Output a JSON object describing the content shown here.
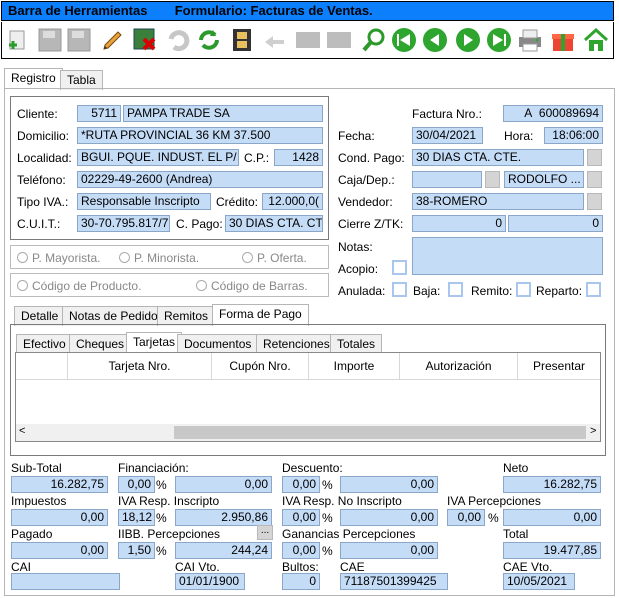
{
  "title": {
    "app": "Barra de Herramientas",
    "form": "Formulario: Facturas de Ventas."
  },
  "toolbar_icons": [
    "new-icon",
    "save-icon",
    "save-as-icon",
    "edit-icon",
    "delete-icon",
    "undo-icon",
    "refresh-icon",
    "film-icon",
    "back-arrow-icon",
    "blank1-icon",
    "blank2-icon",
    "search-icon",
    "first-icon",
    "prev-icon",
    "next-icon",
    "last-icon",
    "printer-icon",
    "gift-icon",
    "home-icon"
  ],
  "main_tabs": [
    "Registro",
    "Tabla"
  ],
  "cliente": {
    "label": "Cliente:",
    "code": "5711",
    "name": "PAMPA TRADE SA"
  },
  "domicilio": {
    "label": "Domicilio:",
    "value": "*RUTA PROVINCIAL 36 KM 37.500"
  },
  "localidad": {
    "label": "Localidad:",
    "value": "BGUI. PQUE. INDUST. EL P/",
    "cp_label": "C.P.:",
    "cp": "1428"
  },
  "telefono": {
    "label": "Teléfono:",
    "value": "02229-49-2600 (Andrea)"
  },
  "tipo_iva": {
    "label": "Tipo IVA.:",
    "value": "Responsable Inscripto",
    "credito_label": "Crédito:",
    "credito": "12.000,0("
  },
  "cuit": {
    "label": "C.U.I.T.:",
    "value": "30-70.795.817/7",
    "cpago_label": "C. Pago:",
    "cpago": "30 DIAS CTA. CT"
  },
  "factura": {
    "label": "Factura Nro.:",
    "letra": "A",
    "numero": "600089694"
  },
  "fecha": {
    "label": "Fecha:",
    "value": "30/04/2021",
    "hora_label": "Hora:",
    "hora": "18:06:00"
  },
  "cond_pago": {
    "label": "Cond. Pago:",
    "value": "30 DIAS CTA. CTE."
  },
  "caja": {
    "label": "Caja/Dep.:",
    "value": "",
    "dep": "RODOLFO ..."
  },
  "vendedor": {
    "label": "Vendedor:",
    "value": "38-ROMERO"
  },
  "cierre": {
    "label": "Cierre Z/TK:",
    "v1": "0",
    "v2": "0"
  },
  "notas": {
    "label": "Notas:",
    "value": ""
  },
  "acopio": {
    "label": "Acopio:"
  },
  "flags": {
    "anulada": "Anulada:",
    "baja": "Baja:",
    "remito": "Remito:",
    "reparto": "Reparto:"
  },
  "precios": [
    "P. Mayorista.",
    "P. Minorista.",
    "P. Oferta."
  ],
  "codigos": [
    "Código de Producto.",
    "Código de Barras."
  ],
  "detail_tabs": [
    "Detalle",
    "Notas de Pedido",
    "Remitos",
    "Forma de Pago"
  ],
  "pago_tabs": [
    "Efectivo",
    "Cheques",
    "Tarjetas",
    "Documentos",
    "Retenciones",
    "Totales"
  ],
  "grid_cols": [
    "Tarjeta Nro.",
    "Cupón Nro.",
    "Importe",
    "Autorización",
    "Presentar"
  ],
  "totals": {
    "subtotal": {
      "label": "Sub-Total",
      "value": "16.282,75"
    },
    "financiacion": {
      "label": "Financiación:",
      "pct": "0,00",
      "value": "0,00"
    },
    "descuento": {
      "label": "Descuento:",
      "pct": "0,00",
      "value": "0,00"
    },
    "neto": {
      "label": "Neto",
      "value": "16.282,75"
    },
    "impuestos": {
      "label": "Impuestos",
      "value": "0,00"
    },
    "iva_ri": {
      "label": "IVA Resp. Inscripto",
      "pct": "18,12",
      "value": "2.950,86"
    },
    "iva_rni": {
      "label": "IVA Resp. No Inscripto",
      "pct": "0,00",
      "value": "0,00"
    },
    "iva_perc": {
      "label": "IVA Percepciones",
      "pct": "0,00",
      "value": "0,00"
    },
    "pagado": {
      "label": "Pagado",
      "value": "0,00"
    },
    "iibb": {
      "label": "IIBB. Percepciones",
      "pct": "1,50",
      "value": "244,24"
    },
    "ganancias": {
      "label": "Ganancias Percepciones",
      "pct": "0,00",
      "value": "0,00"
    },
    "total": {
      "label": "Total",
      "value": "19.477,85"
    },
    "cai": {
      "label": "CAI",
      "value": ""
    },
    "cai_vto": {
      "label": "CAI Vto.",
      "value": "01/01/1900"
    },
    "bultos": {
      "label": "Bultos:",
      "value": "0"
    },
    "cae": {
      "label": "CAE",
      "value": "71187501399425"
    },
    "cae_vto": {
      "label": "CAE Vto.",
      "value": "10/05/2021"
    },
    "pct_sign": "%",
    "ellipsis": "..."
  }
}
